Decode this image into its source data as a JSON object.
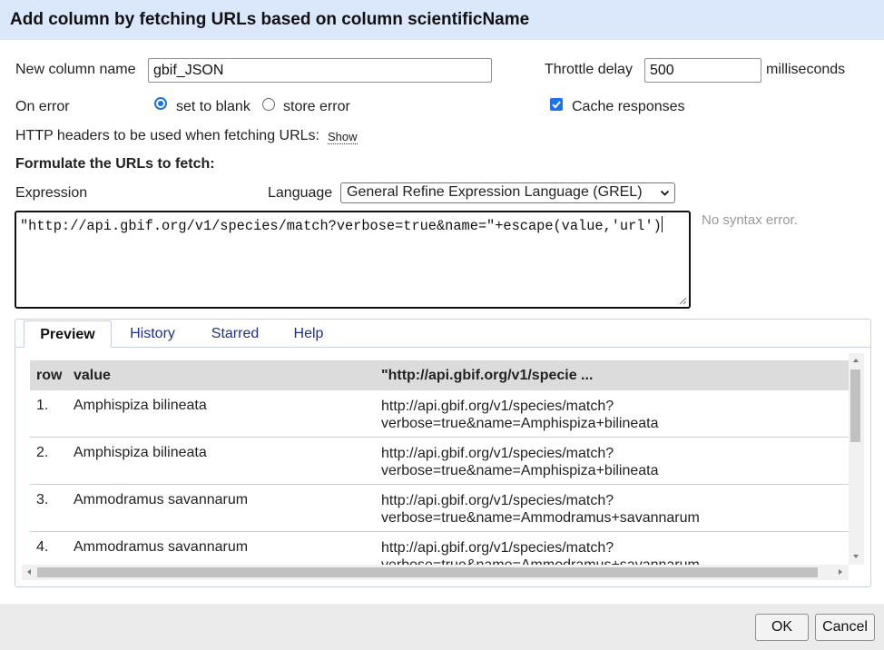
{
  "dialog": {
    "title": "Add column by fetching URLs based on column scientificName"
  },
  "form": {
    "new_column_label": "New column name",
    "new_column_value": "gbif_JSON",
    "throttle_label": "Throttle delay",
    "throttle_value": "500",
    "throttle_unit": "milliseconds",
    "on_error_label": "On error",
    "on_error_options": [
      "set to blank",
      "store error"
    ],
    "on_error_selected": "set to blank",
    "cache_label": "Cache responses",
    "cache_checked": true,
    "http_headers_label": "HTTP headers to be used when fetching URLs:",
    "http_headers_show": "Show",
    "formulate_label": "Formulate the URLs to fetch:"
  },
  "expression": {
    "label": "Expression",
    "language_label": "Language",
    "language_selected": "General Refine Expression Language (GREL)",
    "value": "\"http://api.gbif.org/v1/species/match?verbose=true&name=\"+escape(value,'url')",
    "status": "No syntax error."
  },
  "tabs": [
    {
      "label": "Preview",
      "active": true
    },
    {
      "label": "History",
      "active": false
    },
    {
      "label": "Starred",
      "active": false
    },
    {
      "label": "Help",
      "active": false
    }
  ],
  "preview": {
    "columns": [
      "row",
      "value",
      "\"http://api.gbif.org/v1/specie ..."
    ],
    "rows": [
      {
        "num": "1.",
        "value": "Amphispiza bilineata",
        "res1": "http://api.gbif.org/v1/species/match?",
        "res2": "verbose=true&name=Amphispiza+bilineata"
      },
      {
        "num": "2.",
        "value": "Amphispiza bilineata",
        "res1": "http://api.gbif.org/v1/species/match?",
        "res2": "verbose=true&name=Amphispiza+bilineata"
      },
      {
        "num": "3.",
        "value": "Ammodramus savannarum",
        "res1": "http://api.gbif.org/v1/species/match?",
        "res2": "verbose=true&name=Ammodramus+savannarum"
      },
      {
        "num": "4.",
        "value": "Ammodramus savannarum",
        "res1": "http://api.gbif.org/v1/species/match?",
        "res2": "verbose=true&name=Ammodramus+savannarum"
      }
    ]
  },
  "buttons": {
    "ok": "OK",
    "cancel": "Cancel"
  },
  "colors": {
    "titlebar": "#dbe8fb",
    "accent": "#1a73e8",
    "tab_link": "#1f2f8c"
  },
  "icons": {
    "language_dropdown": "chevron-down-icon",
    "cache_check": "check-icon",
    "resize": "resize-grip-icon"
  }
}
